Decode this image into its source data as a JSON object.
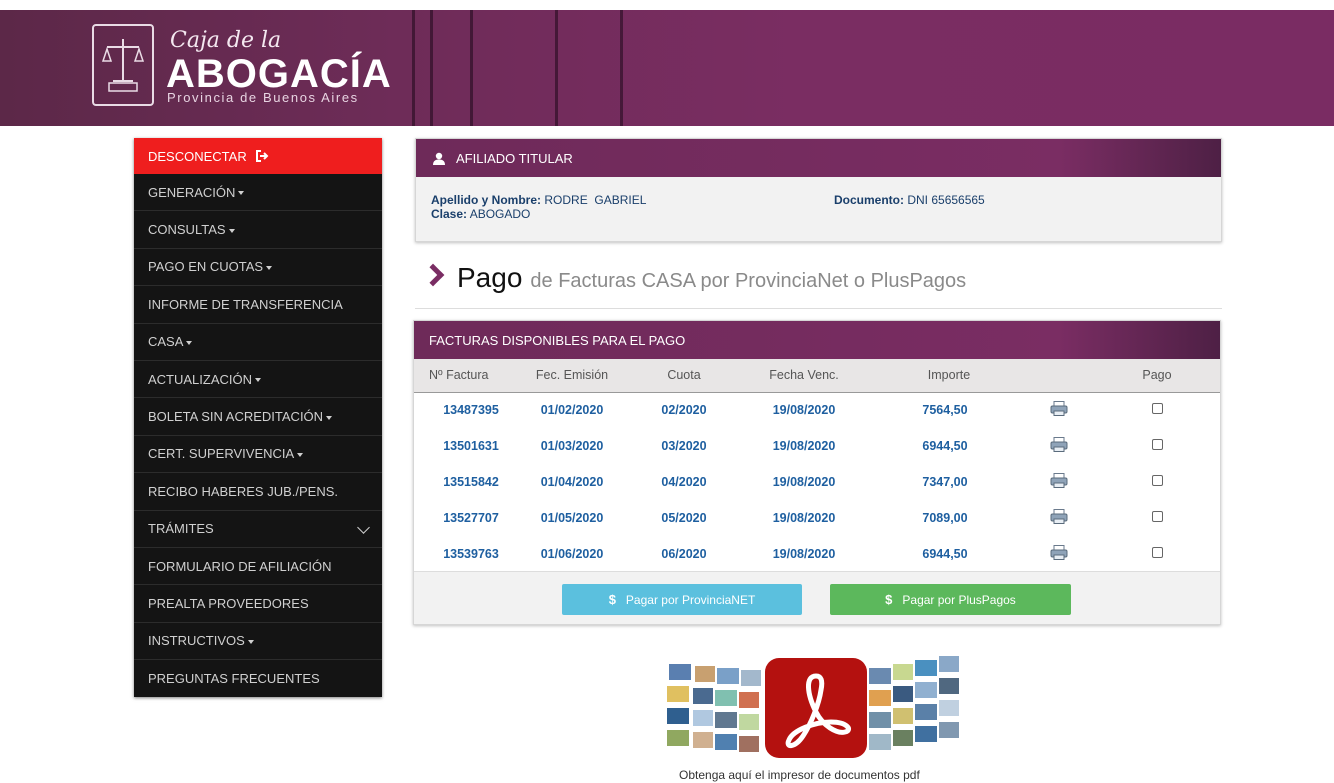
{
  "header": {
    "logo_script": "Caja de la",
    "logo_main": "ABOGACÍA",
    "logo_sub": "Provincia de Buenos Aires"
  },
  "sidebar": {
    "items": [
      {
        "label": "DESCONECTAR",
        "icon": "logout-icon"
      },
      {
        "label": "GENERACIÓN",
        "dropdown": true
      },
      {
        "label": "CONSULTAS",
        "dropdown": true
      },
      {
        "label": "PAGO EN CUOTAS",
        "dropdown": true
      },
      {
        "label": "INFORME DE TRANSFERENCIA"
      },
      {
        "label": "CASA",
        "dropdown": true
      },
      {
        "label": "ACTUALIZACIÓN",
        "dropdown": true
      },
      {
        "label": "BOLETA SIN ACREDITACIÓN",
        "dropdown": true
      },
      {
        "label": "CERT. SUPERVIVENCIA",
        "dropdown": true
      },
      {
        "label": "RECIBO HABERES JUB./PENS."
      },
      {
        "label": "TRÁMITES",
        "chevron": true
      },
      {
        "label": "FORMULARIO DE AFILIACIÓN"
      },
      {
        "label": "PREALTA PROVEEDORES"
      },
      {
        "label": "INSTRUCTIVOS",
        "dropdown": true
      },
      {
        "label": "PREGUNTAS FRECUENTES"
      }
    ]
  },
  "afiliado": {
    "title": "AFILIADO TITULAR",
    "nombre_label": "Apellido y Nombre:",
    "nombre_value": "RODRE  GABRIEL",
    "clase_label": "Clase:",
    "clase_value": "ABOGADO",
    "documento_label": "Documento:",
    "documento_value": "DNI 65656565"
  },
  "page_title": {
    "main": "Pago",
    "sub": "de Facturas CASA por ProvinciaNet o PlusPagos"
  },
  "facturas": {
    "title": "FACTURAS DISPONIBLES PARA EL PAGO",
    "columns": [
      "Nº Factura",
      "Fec. Emisión",
      "Cuota",
      "Fecha Venc.",
      "Importe",
      "",
      "Pago"
    ],
    "rows": [
      {
        "numero": "13487395",
        "emision": "01/02/2020",
        "cuota": "02/2020",
        "venc": "19/08/2020",
        "importe": "7564,50"
      },
      {
        "numero": "13501631",
        "emision": "01/03/2020",
        "cuota": "03/2020",
        "venc": "19/08/2020",
        "importe": "6944,50"
      },
      {
        "numero": "13515842",
        "emision": "01/04/2020",
        "cuota": "04/2020",
        "venc": "19/08/2020",
        "importe": "7347,00"
      },
      {
        "numero": "13527707",
        "emision": "01/05/2020",
        "cuota": "05/2020",
        "venc": "19/08/2020",
        "importe": "7089,00"
      },
      {
        "numero": "13539763",
        "emision": "01/06/2020",
        "cuota": "06/2020",
        "venc": "19/08/2020",
        "importe": "6944,50"
      }
    ],
    "btn_provincia": "Pagar por ProvinciaNET",
    "btn_pluspagos": "Pagar por PlusPagos",
    "dollar": "$"
  },
  "pdf": {
    "caption": "Obtenga aquí el impresor de documentos pdf"
  },
  "colors": {
    "brand": "#7a2d63",
    "logout": "#ef1e1e",
    "link": "#1e5fa0",
    "btn_info": "#5bc0de",
    "btn_success": "#5cb85c"
  }
}
